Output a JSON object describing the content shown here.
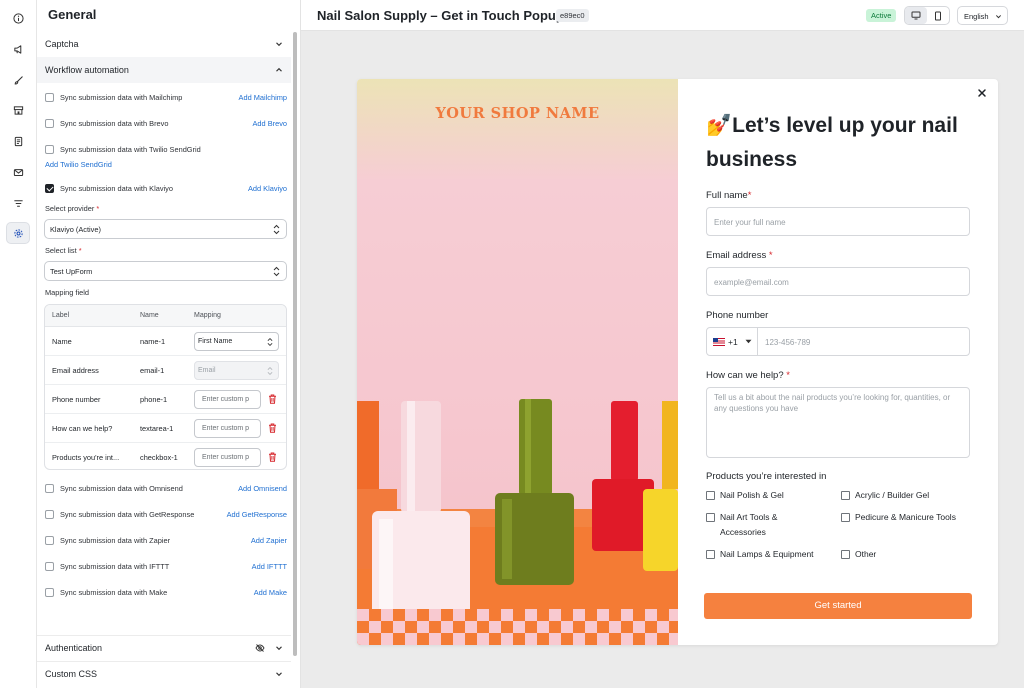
{
  "panel": {
    "title": "General"
  },
  "sections": {
    "captcha": "Captcha",
    "workflow": "Workflow automation",
    "authentication": "Authentication",
    "custom_css": "Custom CSS"
  },
  "integrations": [
    {
      "label": "Sync submission data with Mailchimp",
      "link": "Add Mailchimp",
      "checked": false
    },
    {
      "label": "Sync submission data with Brevo",
      "link": "Add Brevo",
      "checked": false
    },
    {
      "label": "Sync submission data with Twilio SendGrid",
      "link": "Add Twilio SendGrid",
      "checked": false
    },
    {
      "label": "Sync submission data with Klaviyo",
      "link": "Add Klaviyo",
      "checked": true
    }
  ],
  "klaviyo": {
    "provider_label": "Select provider",
    "provider_value": "Klaviyo (Active)",
    "list_label": "Select list",
    "list_value": "Test UpForm",
    "required_mark": "*",
    "mapping_label": "Mapping field"
  },
  "mapping": {
    "headers": {
      "label": "Label",
      "name": "Name",
      "mapping": "Mapping"
    },
    "rows": [
      {
        "label": "Name",
        "name": "name-1",
        "mapping": "First Name",
        "kind": "select"
      },
      {
        "label": "Email address",
        "name": "email-1",
        "mapping": "Email",
        "kind": "disabled"
      },
      {
        "label": "Phone number",
        "name": "phone-1",
        "mapping": "Enter custom p",
        "kind": "input"
      },
      {
        "label": "How can we help?",
        "name": "textarea-1",
        "mapping": "Enter custom p",
        "kind": "input"
      },
      {
        "label": "Products you're int...",
        "name": "checkbox-1",
        "mapping": "Enter custom p",
        "kind": "input"
      }
    ]
  },
  "more_integrations": [
    {
      "label": "Sync submission data with Omnisend",
      "link": "Add Omnisend"
    },
    {
      "label": "Sync submission data with GetResponse",
      "link": "Add GetResponse"
    },
    {
      "label": "Sync submission data with Zapier",
      "link": "Add Zapier"
    },
    {
      "label": "Sync submission data with IFTTT",
      "link": "Add IFTTT"
    },
    {
      "label": "Sync submission data with Make",
      "link": "Add Make"
    }
  ],
  "topbar": {
    "title": "Nail Salon Supply – Get in Touch Popup",
    "id_badge": "e89ec0",
    "status": "Active",
    "language": "English"
  },
  "popup": {
    "shop_name": "YOUR SHOP NAME",
    "headline_emoji": "💅",
    "headline": "Let’s level up your nail business",
    "full_name_label": "Full name",
    "full_name_placeholder": "Enter your full name",
    "email_label": "Email address",
    "email_placeholder": "example@email.com",
    "phone_label": "Phone number",
    "phone_code": "+1",
    "phone_placeholder": "123-456-789",
    "help_label": "How can we help?",
    "help_placeholder": "Tell us a bit about the nail products you’re looking for, quantities, or any questions you have",
    "products_label": "Products you’re interested in",
    "products": [
      "Nail Polish & Gel",
      "Acrylic / Builder Gel",
      "Nail Art Tools & Accessories",
      "Pedicure & Manicure Tools",
      "Nail Lamps & Equipment",
      "Other"
    ],
    "cta": "Get started",
    "required_mark": "*"
  },
  "colors": {
    "accent_orange": "#f5813f",
    "link_blue": "#1f6fd1",
    "active_green_bg": "#c9f3d8",
    "required_red": "#d6262b"
  }
}
